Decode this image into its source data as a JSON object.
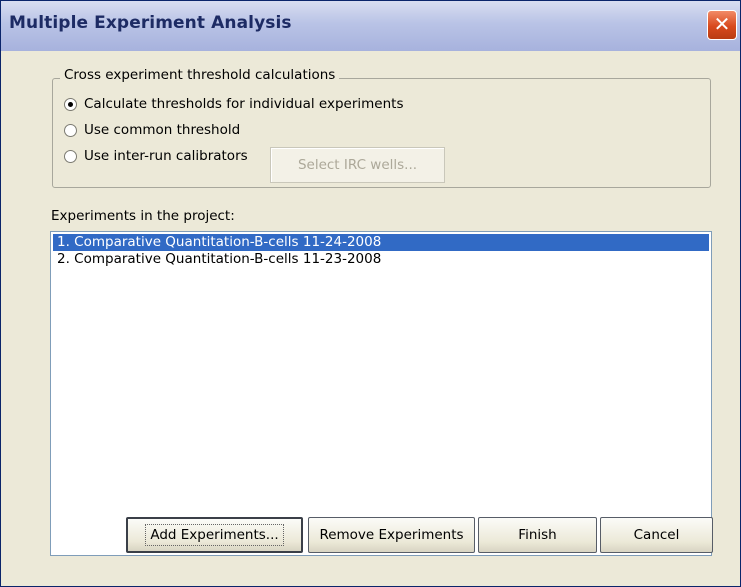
{
  "window": {
    "title": "Multiple Experiment Analysis",
    "close_glyph": "✕"
  },
  "threshold_group": {
    "legend": "Cross experiment threshold calculations",
    "options": [
      {
        "label": "Calculate thresholds for individual experiments",
        "selected": true
      },
      {
        "label": "Use common threshold",
        "selected": false
      },
      {
        "label": "Use inter-run calibrators",
        "selected": false
      }
    ],
    "select_irc_button": "Select IRC wells..."
  },
  "experiments": {
    "label": "Experiments in the project:",
    "items": [
      {
        "text": "1. Comparative Quantitation-B-cells 11-24-2008",
        "selected": true
      },
      {
        "text": "2. Comparative Quantitation-B-cells 11-23-2008",
        "selected": false
      }
    ]
  },
  "buttons": {
    "add": "Add Experiments...",
    "remove": "Remove Experiments",
    "finish": "Finish",
    "cancel": "Cancel"
  }
}
